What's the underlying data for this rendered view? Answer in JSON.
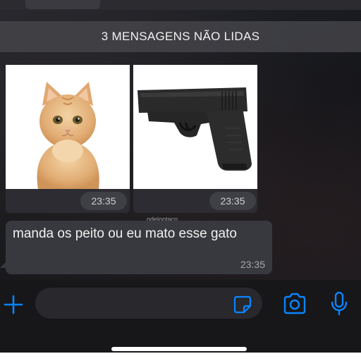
{
  "banner": {
    "unread_label": "3 MENSAGENS NÃO LIDAS"
  },
  "images": [
    {
      "subject": "cat photo",
      "time": "23:35"
    },
    {
      "subject": "pistol photo",
      "time": "23:35"
    }
  ],
  "watermark": "odelootaco",
  "message": {
    "text": "manda os peito ou eu mato esse gato",
    "time": "23:35"
  },
  "input_bar": {
    "icons": [
      "plus-icon",
      "sticker-icon",
      "camera-icon",
      "microphone-icon"
    ],
    "accent": "#0a84ff"
  },
  "colors": {
    "bubble": "#38393e",
    "banner_text": "#f2f2f2",
    "timestamp": "#a7a7ab"
  }
}
